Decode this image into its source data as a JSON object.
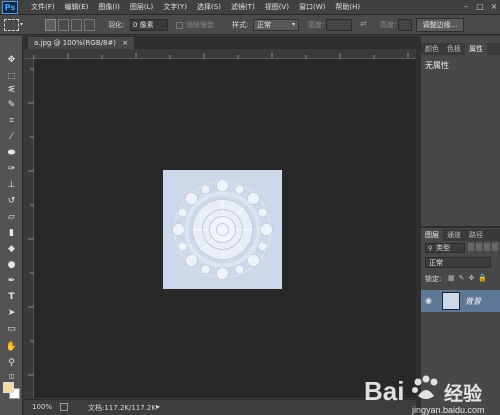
{
  "app": {
    "logo": "Ps"
  },
  "menu": [
    "文件(F)",
    "编辑(E)",
    "图像(I)",
    "图层(L)",
    "文字(Y)",
    "选择(S)",
    "滤镜(T)",
    "视图(V)",
    "窗口(W)",
    "帮助(H)"
  ],
  "window_buttons": [
    "–",
    "□",
    "×"
  ],
  "options": {
    "feather_label": "羽化:",
    "feather_value": "0 像素",
    "antialias_label": "消除锯齿",
    "style_label": "样式:",
    "style_value": "正常",
    "width_label": "宽度:",
    "height_label": "高度:",
    "refine_edge_button": "调整边缘..."
  },
  "document": {
    "tab_title": "a.jpg @ 100%(RGB/8#)",
    "tab_close": "×",
    "zoom": "100%",
    "doc_size": "文档:117.2K/117.2K"
  },
  "panels_top": {
    "tabs": [
      "颜色",
      "色板",
      "属性"
    ],
    "active_tab": "属性",
    "content": "无属性"
  },
  "layers_panel": {
    "tabs": [
      "图层",
      "通道",
      "路径"
    ],
    "filter_label": "类型",
    "blend_mode": "正常",
    "lock_label": "锁定:",
    "layer_name": "背景"
  },
  "watermark": {
    "brand": "Bai",
    "brand2": "经验",
    "url": "jingyan.baidu.com"
  },
  "colors": {
    "foreground": "#f5d9a1",
    "background": "#ffffff",
    "artboard": "#cdd8ea",
    "layer_selected": "#5f7896"
  }
}
